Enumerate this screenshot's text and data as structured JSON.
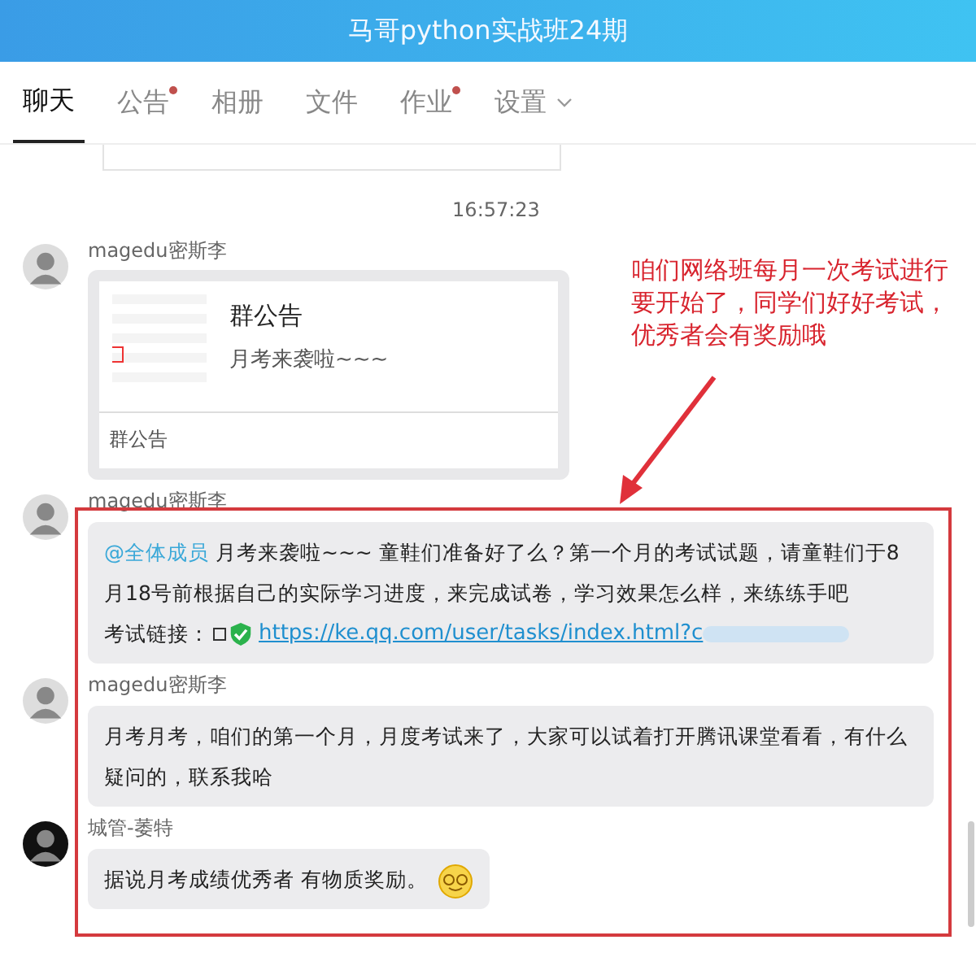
{
  "window": {
    "title": "马哥python实战班24期"
  },
  "tabs": [
    {
      "label": "聊天",
      "selected": true,
      "badge": false,
      "dropdown": false
    },
    {
      "label": "公告",
      "selected": false,
      "badge": true,
      "dropdown": false
    },
    {
      "label": "相册",
      "selected": false,
      "badge": false,
      "dropdown": false
    },
    {
      "label": "文件",
      "selected": false,
      "badge": false,
      "dropdown": false
    },
    {
      "label": "作业",
      "selected": false,
      "badge": true,
      "dropdown": false
    },
    {
      "label": "设置",
      "selected": false,
      "badge": false,
      "dropdown": true
    }
  ],
  "timestamp": "16:57:23",
  "messages": [
    {
      "kind": "card",
      "sender": "magedu密斯李",
      "avatar": {
        "color": "#dddddd"
      },
      "card": {
        "title": "群公告",
        "summary": "月考来袭啦~~~",
        "footer": "群公告"
      }
    },
    {
      "kind": "text",
      "sender": "magedu密斯李",
      "avatar": {
        "color": "#dddddd"
      },
      "mention": "@全体成员",
      "text": "月考来袭啦~~~ 童鞋们准备好了么？第一个月的考试试题，请童鞋们于8月18号前根据自己的实际学习进度，来完成试卷，学习效果怎么样，来练练手吧",
      "link_label": "考试链接：",
      "link": "https://ke.qq.com/user/tasks/index.html?c",
      "emoji": false
    },
    {
      "kind": "text",
      "sender": "magedu密斯李",
      "avatar": {
        "color": "#dddddd"
      },
      "text": "月考月考，咱们的第一个月，月度考试来了，大家可以试着打开腾讯课堂看看，有什么疑问的，联系我哈",
      "emoji": false
    },
    {
      "kind": "text",
      "sender": "城管-萎特",
      "avatar": {
        "color": "#111111"
      },
      "text": "据说月考成绩优秀者 有物质奖励。",
      "emoji": true
    }
  ],
  "annotation": {
    "text": "咱们网络班每月一次考试进行要开始了，同学们好好考试，优秀者会有奖励哦"
  }
}
